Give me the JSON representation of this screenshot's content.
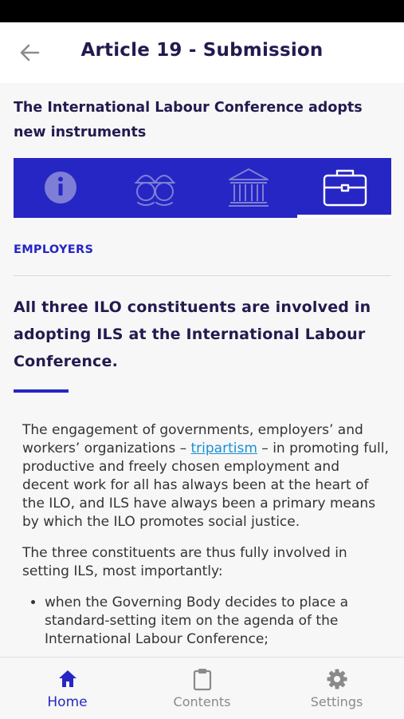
{
  "app_bar": {
    "title": "Article 19 - Submission",
    "back_icon": "arrow-left-icon"
  },
  "subtitle": "The International Labour Conference adopts new instruments",
  "tabs": [
    {
      "icon": "info-icon",
      "selected": false
    },
    {
      "icon": "workers-icon",
      "selected": false
    },
    {
      "icon": "government-building-icon",
      "selected": false
    },
    {
      "icon": "briefcase-icon",
      "selected": true
    }
  ],
  "section_label": "EMPLOYERS",
  "heading": "All three ILO constituents are involved in adopting ILS at the International Labour Conference.",
  "body": {
    "p1_before": "The engagement of governments, employers’ and workers’ organizations – ",
    "p1_link": "tripartism",
    "p1_after": " – in promoting full, productive and freely chosen employment and decent work for all has always been at the heart of the ILO, and ILS have always been a primary means by which the ILO promotes social justice.",
    "p2": "The three constituents are thus fully involved in setting ILS, most importantly:",
    "bullets": [
      "when the Governing Body decides to place a standard-setting item on the agenda of the International Labour Conference;"
    ]
  },
  "bottom_nav": [
    {
      "label": "Home",
      "icon": "home-icon",
      "active": true
    },
    {
      "label": "Contents",
      "icon": "clipboard-icon",
      "active": false
    },
    {
      "label": "Settings",
      "icon": "gear-icon",
      "active": false
    }
  ],
  "colors": {
    "primary": "#2626c4",
    "title_text": "#241a4f",
    "link": "#1a8fd6",
    "inactive": "#8a8a8a"
  }
}
